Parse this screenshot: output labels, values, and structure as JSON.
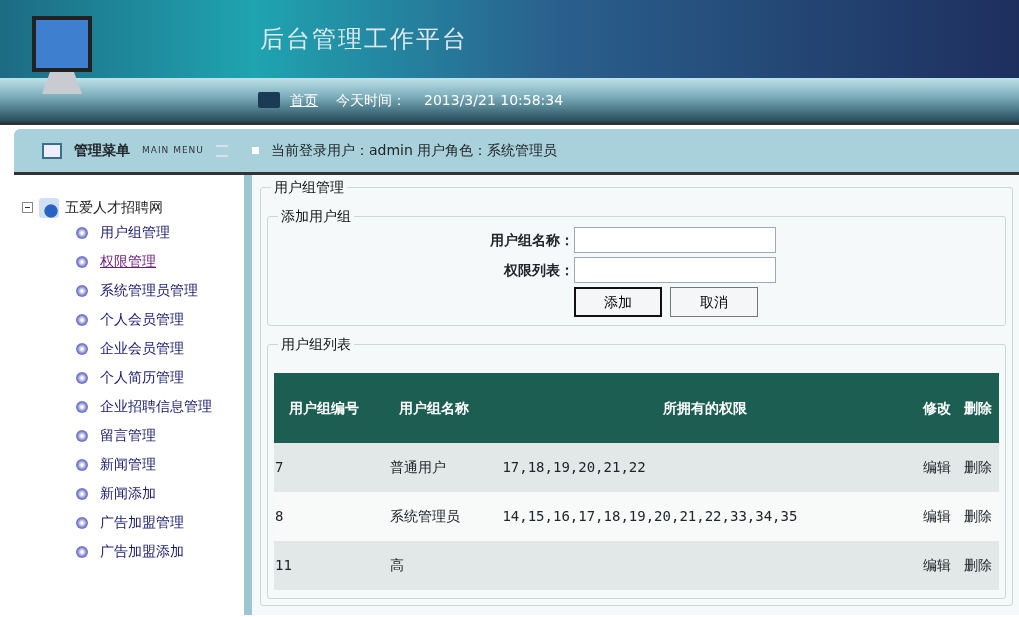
{
  "header": {
    "title": "后台管理工作平台",
    "home_link": "首页",
    "time_label": "今天时间：",
    "time_value": "2013/3/21 10:58:34"
  },
  "menu_bar": {
    "title": "管理菜单",
    "subtitle": "MAIN MENU",
    "user_label": "当前登录用户：",
    "user": "admin",
    "role_label": "用户角色：",
    "role": "系统管理员"
  },
  "sidebar": {
    "root": {
      "label": "五爱人才招聘网",
      "expanded": true,
      "children": [
        {
          "label": "用户组管理",
          "selected": false
        },
        {
          "label": "权限管理",
          "selected": true
        },
        {
          "label": "系统管理员管理",
          "selected": false
        },
        {
          "label": "个人会员管理",
          "selected": false
        },
        {
          "label": "企业会员管理",
          "selected": false
        },
        {
          "label": "个人简历管理",
          "selected": false
        },
        {
          "label": "企业招聘信息管理",
          "selected": false
        },
        {
          "label": "留言管理",
          "selected": false
        },
        {
          "label": "新闻管理",
          "selected": false
        },
        {
          "label": "新闻添加",
          "selected": false
        },
        {
          "label": "广告加盟管理",
          "selected": false
        },
        {
          "label": "广告加盟添加",
          "selected": false
        }
      ]
    }
  },
  "main": {
    "title": "用户组管理",
    "add_form": {
      "title": "添加用户组",
      "fields": [
        {
          "label": "用户组名称："
        },
        {
          "label": "权限列表："
        }
      ],
      "buttons": [
        "添加",
        "取消"
      ]
    },
    "list": {
      "title": "用户组列表",
      "columns": [
        "用户组编号",
        "用户组名称",
        "所拥有的权限",
        "修改",
        "删除"
      ],
      "rows": [
        {
          "id": "7",
          "name": "普通用户",
          "permissions": "17,18,19,20,21,22",
          "edit": "编辑",
          "delete": "删除"
        },
        {
          "id": "8",
          "name": "系统管理员",
          "permissions": "14,15,16,17,18,19,20,21,22,33,34,35",
          "edit": "编辑",
          "delete": "删除"
        },
        {
          "id": "11",
          "name": "高",
          "edit": "编辑",
          "delete": "删除"
        }
      ]
    }
  }
}
